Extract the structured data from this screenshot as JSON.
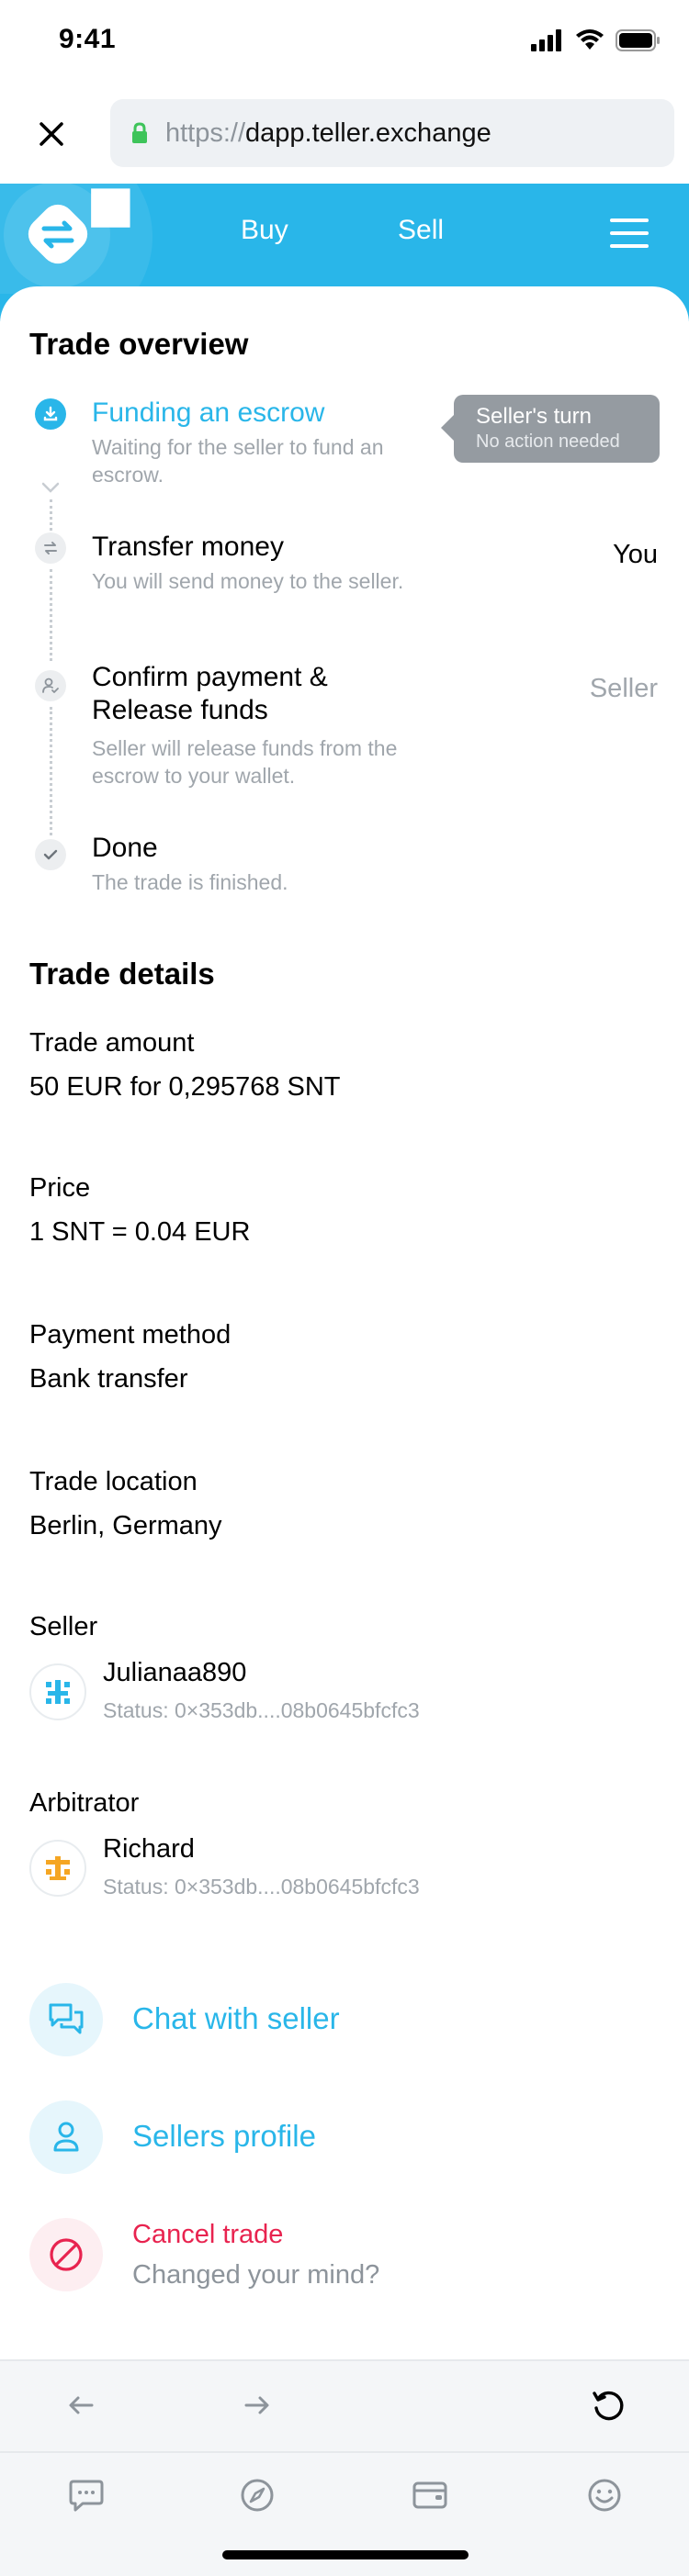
{
  "status_bar": {
    "time": "9:41"
  },
  "browser": {
    "url_protocol": "https://",
    "url_host": "dapp.teller.exchange"
  },
  "header": {
    "nav_buy": "Buy",
    "nav_sell": "Sell"
  },
  "overview": {
    "title": "Trade overview",
    "tooltip": {
      "title": "Seller's turn",
      "subtitle": "No action needed"
    },
    "steps": [
      {
        "title": "Funding an escrow",
        "desc": "Waiting for the seller to fund an escrow.",
        "role": ""
      },
      {
        "title": "Transfer money",
        "desc": "You will send money to the seller.",
        "role": "You"
      },
      {
        "title": "Confirm payment & Release funds",
        "desc": "Seller will release funds from the escrow to your wallet.",
        "role": "Seller"
      },
      {
        "title": "Done",
        "desc": "The trade is finished.",
        "role": ""
      }
    ]
  },
  "details": {
    "title": "Trade details",
    "amount_label": "Trade amount",
    "amount_value": "50 EUR for 0,295768 SNT",
    "price_label": "Price",
    "price_value": "1 SNT = 0.04 EUR",
    "payment_label": "Payment method",
    "payment_value": "Bank transfer",
    "location_label": "Trade location",
    "location_value": "Berlin, Germany",
    "seller_label": "Seller",
    "seller_name": "Julianaa890",
    "seller_status": "Status: 0×353db....08b0645bfcfc3",
    "arbitrator_label": "Arbitrator",
    "arbitrator_name": "Richard",
    "arbitrator_status": "Status: 0×353db....08b0645bfcfc3"
  },
  "actions": {
    "chat": "Chat with seller",
    "profile": "Sellers profile",
    "cancel": "Cancel trade",
    "cancel_sub": "Changed your mind?"
  },
  "colors": {
    "accent": "#29b6e9",
    "danger": "#e8234f",
    "muted": "#a0a6ac",
    "tooltip": "#959ba1"
  }
}
